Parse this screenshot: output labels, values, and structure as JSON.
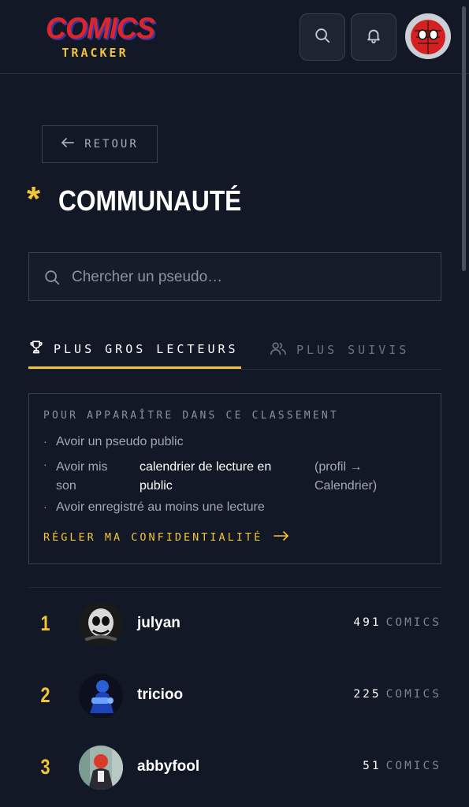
{
  "header": {
    "logo_top": "COMICS",
    "logo_bottom": "TRACKER"
  },
  "back_label": "RETOUR",
  "page_title": "COMMUNAUTÉ",
  "search": {
    "placeholder": "Chercher un pseudo…"
  },
  "tabs": [
    {
      "label": "PLUS GROS LECTEURS",
      "active": true,
      "icon": "trophy-icon"
    },
    {
      "label": "PLUS SUIVIS",
      "active": false,
      "icon": "users-icon"
    }
  ],
  "info": {
    "title": "POUR APPARAÎTRE DANS CE CLASSEMENT",
    "bullets": [
      "Avoir un pseudo public",
      "Avoir mis son calendrier de lecture en public (profil → Calendrier)",
      "Avoir enregistré au moins une lecture"
    ],
    "bullet2_parts": {
      "a": "Avoir mis son",
      "b": "calendrier de lecture en public",
      "c": "(profil → Calendrier)"
    },
    "link": "RÉGLER MA CONFIDENTIALITÉ"
  },
  "leaderboard": [
    {
      "rank": "1",
      "name": "julyan",
      "count": "491",
      "unit": "COMICS"
    },
    {
      "rank": "2",
      "name": "tricioo",
      "count": "225",
      "unit": "COMICS"
    },
    {
      "rank": "3",
      "name": "abbyfool",
      "count": "51",
      "unit": "COMICS"
    }
  ],
  "colors": {
    "accent": "#f2c438",
    "background": "#121826",
    "logo_red": "#e0242c"
  }
}
